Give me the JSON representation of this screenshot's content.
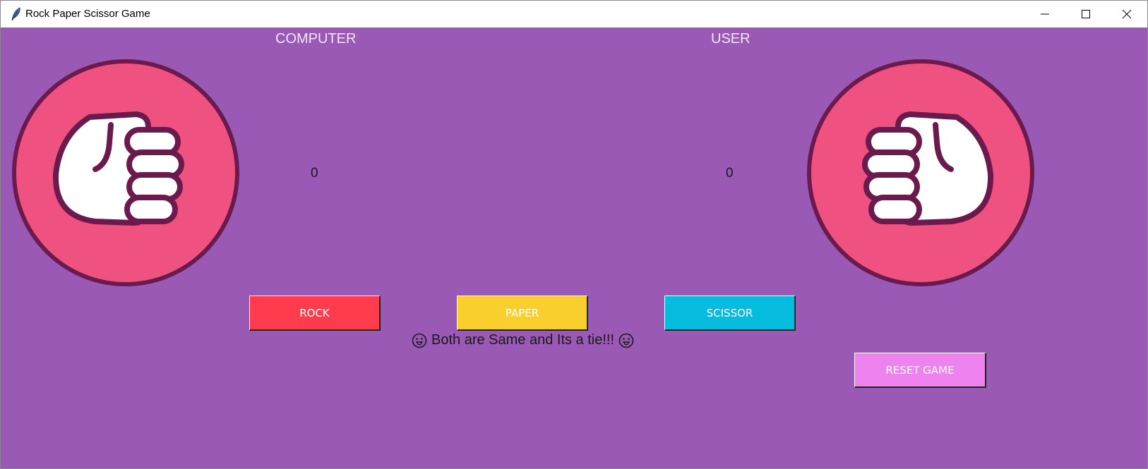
{
  "window": {
    "title": "Rock Paper Scissor Game",
    "app_icon": "feather-icon"
  },
  "labels": {
    "computer": "COMPUTER",
    "user": "USER"
  },
  "scores": {
    "computer": "0",
    "user": "0"
  },
  "choices": {
    "computer": "rock",
    "user": "rock"
  },
  "buttons": {
    "rock": "ROCK",
    "paper": "PAPER",
    "scissor": "SCISSOR",
    "reset": "RESET GAME"
  },
  "result": {
    "text": "Both are Same and Its a tie!!!",
    "emoji": "tongue-out-face-icon"
  },
  "colors": {
    "background": "#9b59b6",
    "rock": "#ff3b4e",
    "paper": "#f9cf2e",
    "scissor": "#06bcde",
    "reset": "#ee82ee",
    "hand_circle": "#ef5280",
    "hand_outline": "#6a1a4c"
  }
}
